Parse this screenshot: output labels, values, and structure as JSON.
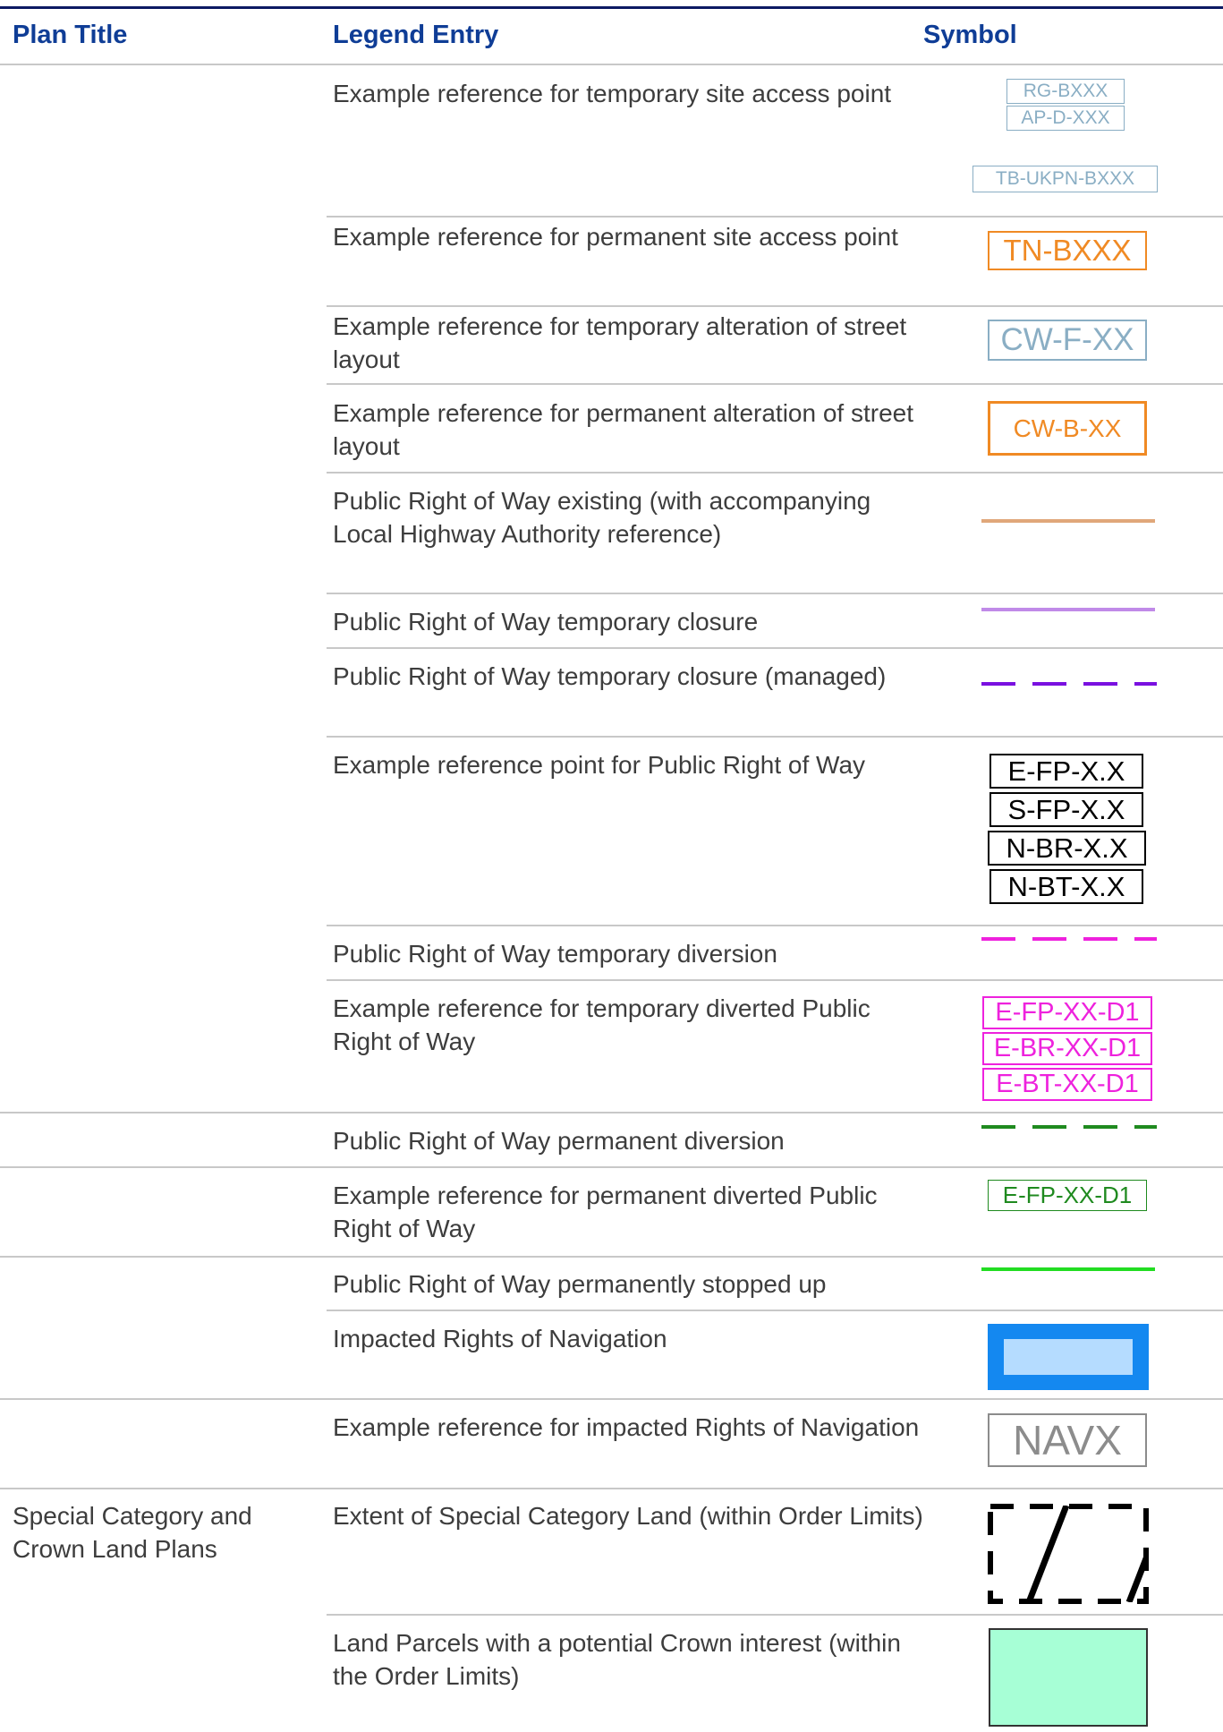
{
  "header": {
    "plan_title": "Plan Title",
    "legend_entry": "Legend Entry",
    "symbol": "Symbol"
  },
  "rows": [
    {
      "entry": "Example reference for temporary site access point",
      "symbol": {
        "labels": [
          "RG-BXXX",
          "AP-D-XXX",
          "TB-UKPN-BXXX"
        ],
        "color": "#8aaec4"
      }
    },
    {
      "entry": "Example reference for permanent site access point",
      "symbol": {
        "labels": [
          "TN-BXXX"
        ],
        "color": "#f08a24"
      }
    },
    {
      "entry": "Example reference for temporary alteration of street layout",
      "symbol": {
        "labels": [
          "CW-F-XX"
        ],
        "color": "#8aaec4"
      }
    },
    {
      "entry": "Example reference for permanent alteration of street layout",
      "symbol": {
        "labels": [
          "CW-B-XX"
        ],
        "color": "#f08a24"
      }
    },
    {
      "entry": "Public Right of Way existing (with accompanying Local Highway Authority reference)",
      "symbol": {
        "type": "solid-line",
        "color": "#e0a77a"
      }
    },
    {
      "entry": "Public Right of Way temporary closure",
      "symbol": {
        "type": "solid-line",
        "color": "#c08ae8"
      }
    },
    {
      "entry": "Public Right of Way temporary closure (managed)",
      "symbol": {
        "type": "dashed-line",
        "color": "#7a10e0"
      }
    },
    {
      "entry": "Example reference point for Public Right of Way",
      "symbol": {
        "labels": [
          "E-FP-X.X",
          "S-FP-X.X",
          "N-BR-X.X",
          "N-BT-X.X"
        ],
        "color": "#000000"
      }
    },
    {
      "entry": "Public Right of Way temporary diversion",
      "symbol": {
        "type": "dashed-line",
        "color": "#ee22dd"
      }
    },
    {
      "entry": "Example reference for temporary diverted Public Right of Way",
      "symbol": {
        "labels": [
          "E-FP-XX-D1",
          "E-BR-XX-D1",
          "E-BT-XX-D1"
        ],
        "color": "#ee22dd"
      }
    },
    {
      "entry": "Public Right of Way permanent diversion",
      "symbol": {
        "type": "dashed-line",
        "color": "#1f8a1f"
      }
    },
    {
      "entry": "Example reference for permanent diverted Public Right of Way",
      "symbol": {
        "labels": [
          "E-FP-XX-D1"
        ],
        "color": "#1f8a1f"
      }
    },
    {
      "entry": "Public Right of Way permanently stopped up",
      "symbol": {
        "type": "solid-line",
        "color": "#22dd22"
      }
    },
    {
      "entry": "Impacted Rights of Navigation",
      "symbol": {
        "type": "filled-box",
        "color": "#1488f0",
        "inner_color": "#b5dcff"
      }
    },
    {
      "entry": "Example reference for impacted Rights of Navigation",
      "symbol": {
        "labels": [
          "NAVX"
        ],
        "color": "#8c8c8c"
      }
    },
    {
      "plan": "Special Category and Crown Land Plans",
      "entry": "Extent of Special Category Land (within Order Limits)",
      "symbol": {
        "type": "dashed-hatched-box",
        "color": "#000000"
      }
    },
    {
      "entry": "Land Parcels with a potential Crown interest (within the Order Limits)",
      "symbol": {
        "type": "filled-box",
        "color": "#a7ffd6",
        "border": "#333333"
      }
    }
  ]
}
